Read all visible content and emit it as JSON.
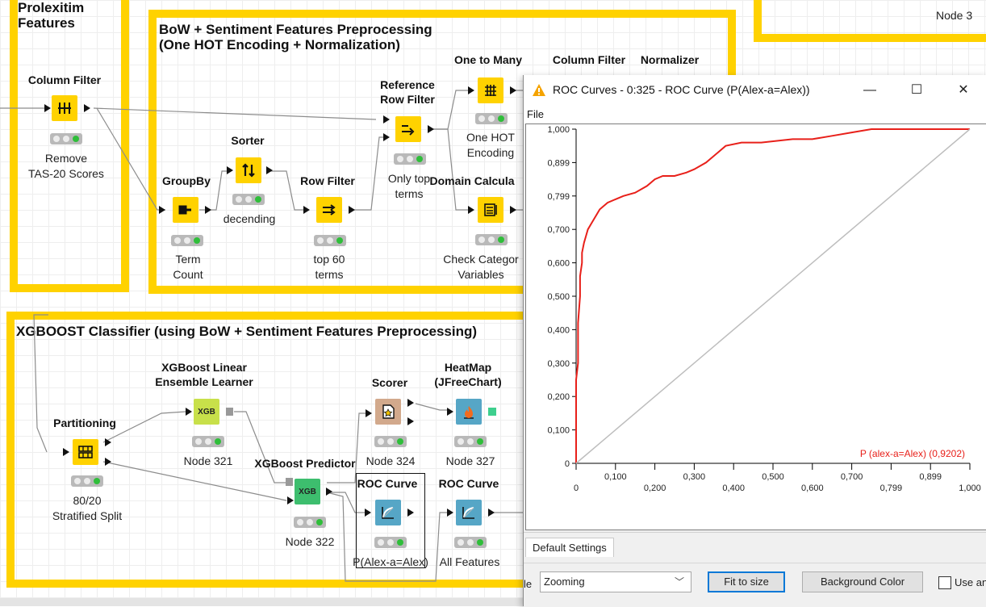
{
  "workflow": {
    "annotations": {
      "prolexitim": "Prolexitim\nFeatures",
      "bow": "BoW + Sentiment Features Preprocessing\n(One HOT Encoding + Normalization)",
      "xgboost": "XGBOOST Classifier (using BoW + Sentiment Features Preprocessing)",
      "node3_partial": "Node 3"
    },
    "nodes": {
      "column_filter": {
        "name": "Column Filter",
        "sub": "Remove\nTAS-20 Scores"
      },
      "groupby": {
        "name": "GroupBy",
        "sub": "Term\nCount"
      },
      "sorter": {
        "name": "Sorter",
        "sub": "decending"
      },
      "row_filter": {
        "name": "Row Filter",
        "sub": "top 60\nterms"
      },
      "ref_row_filter": {
        "name": "Reference\nRow Filter",
        "sub": "Only top\nterms"
      },
      "one_to_many": {
        "name": "One to Many",
        "sub": "One HOT\nEncoding"
      },
      "column_filter2": {
        "name": "Column Filter"
      },
      "normalizer": {
        "name": "Normalizer"
      },
      "domain_calc": {
        "name": "Domain Calcula",
        "sub": "Check Categor\nVariables"
      },
      "partitioning": {
        "name": "Partitioning",
        "sub": "80/20\nStratified Split"
      },
      "xgb_learner": {
        "name": "XGBoost Linear\nEnsemble Learner",
        "sub": "Node 321",
        "icon": "XGB"
      },
      "xgb_predictor": {
        "name": "XGBoost Predictor",
        "sub": "Node 322",
        "icon": "XGB"
      },
      "scorer": {
        "name": "Scorer",
        "sub": "Node 324"
      },
      "heatmap": {
        "name": "HeatMap\n(JFreeChart)",
        "sub": "Node 327"
      },
      "roc1": {
        "name": "ROC Curve",
        "sub": "P(Alex-a=Alex)"
      },
      "roc2": {
        "name": "ROC Curve",
        "sub": "All Features"
      }
    }
  },
  "roc_window": {
    "title": "ROC Curves - 0:325 - ROC Curve (P(Alex-a=Alex))",
    "controls": {
      "minimize": "—",
      "maximize": "☐",
      "close": "✕"
    },
    "menu_file": "File",
    "tab": "Default Settings",
    "mode_label_partial": "le",
    "mode_select": "Zooming",
    "fit_button": "Fit to size",
    "bg_button": "Background Color",
    "checkbox_label_partial": "Use an",
    "colors": {
      "curve": "#E8201A",
      "diagonal": "#BDBDBD"
    }
  },
  "chart_data": {
    "type": "line",
    "title": "",
    "xlabel": "",
    "ylabel": "",
    "xlim": [
      0,
      1
    ],
    "ylim": [
      0,
      1
    ],
    "x_tick_labels": [
      "0",
      "0,100",
      "0,200",
      "0,300",
      "0,400",
      "0,500",
      "0,600",
      "0,700",
      "0,799",
      "0,899",
      "1,000"
    ],
    "y_tick_labels": [
      "0",
      "0,100",
      "0,200",
      "0,300",
      "0,400",
      "0,500",
      "0,600",
      "0,700",
      "0,799",
      "0,899",
      "1,000"
    ],
    "legend": "bottom-right",
    "series": [
      {
        "name": "P (alex-a=Alex) (0,9202)",
        "color": "#E8201A",
        "x": [
          0,
          0,
          0.005,
          0.005,
          0.01,
          0.01,
          0.015,
          0.015,
          0.02,
          0.025,
          0.03,
          0.04,
          0.05,
          0.06,
          0.08,
          0.1,
          0.12,
          0.15,
          0.18,
          0.2,
          0.22,
          0.25,
          0.28,
          0.3,
          0.33,
          0.36,
          0.38,
          0.42,
          0.47,
          0.55,
          0.6,
          0.65,
          0.7,
          0.75,
          1.0
        ],
        "y": [
          0,
          0.25,
          0.3,
          0.42,
          0.5,
          0.56,
          0.6,
          0.63,
          0.66,
          0.68,
          0.7,
          0.72,
          0.74,
          0.76,
          0.78,
          0.79,
          0.8,
          0.81,
          0.83,
          0.85,
          0.86,
          0.86,
          0.87,
          0.88,
          0.9,
          0.93,
          0.95,
          0.96,
          0.96,
          0.97,
          0.97,
          0.98,
          0.99,
          1.0,
          1.0
        ]
      },
      {
        "name": "",
        "color": "#BDBDBD",
        "x": [
          0,
          1
        ],
        "y": [
          0,
          1
        ]
      }
    ]
  }
}
